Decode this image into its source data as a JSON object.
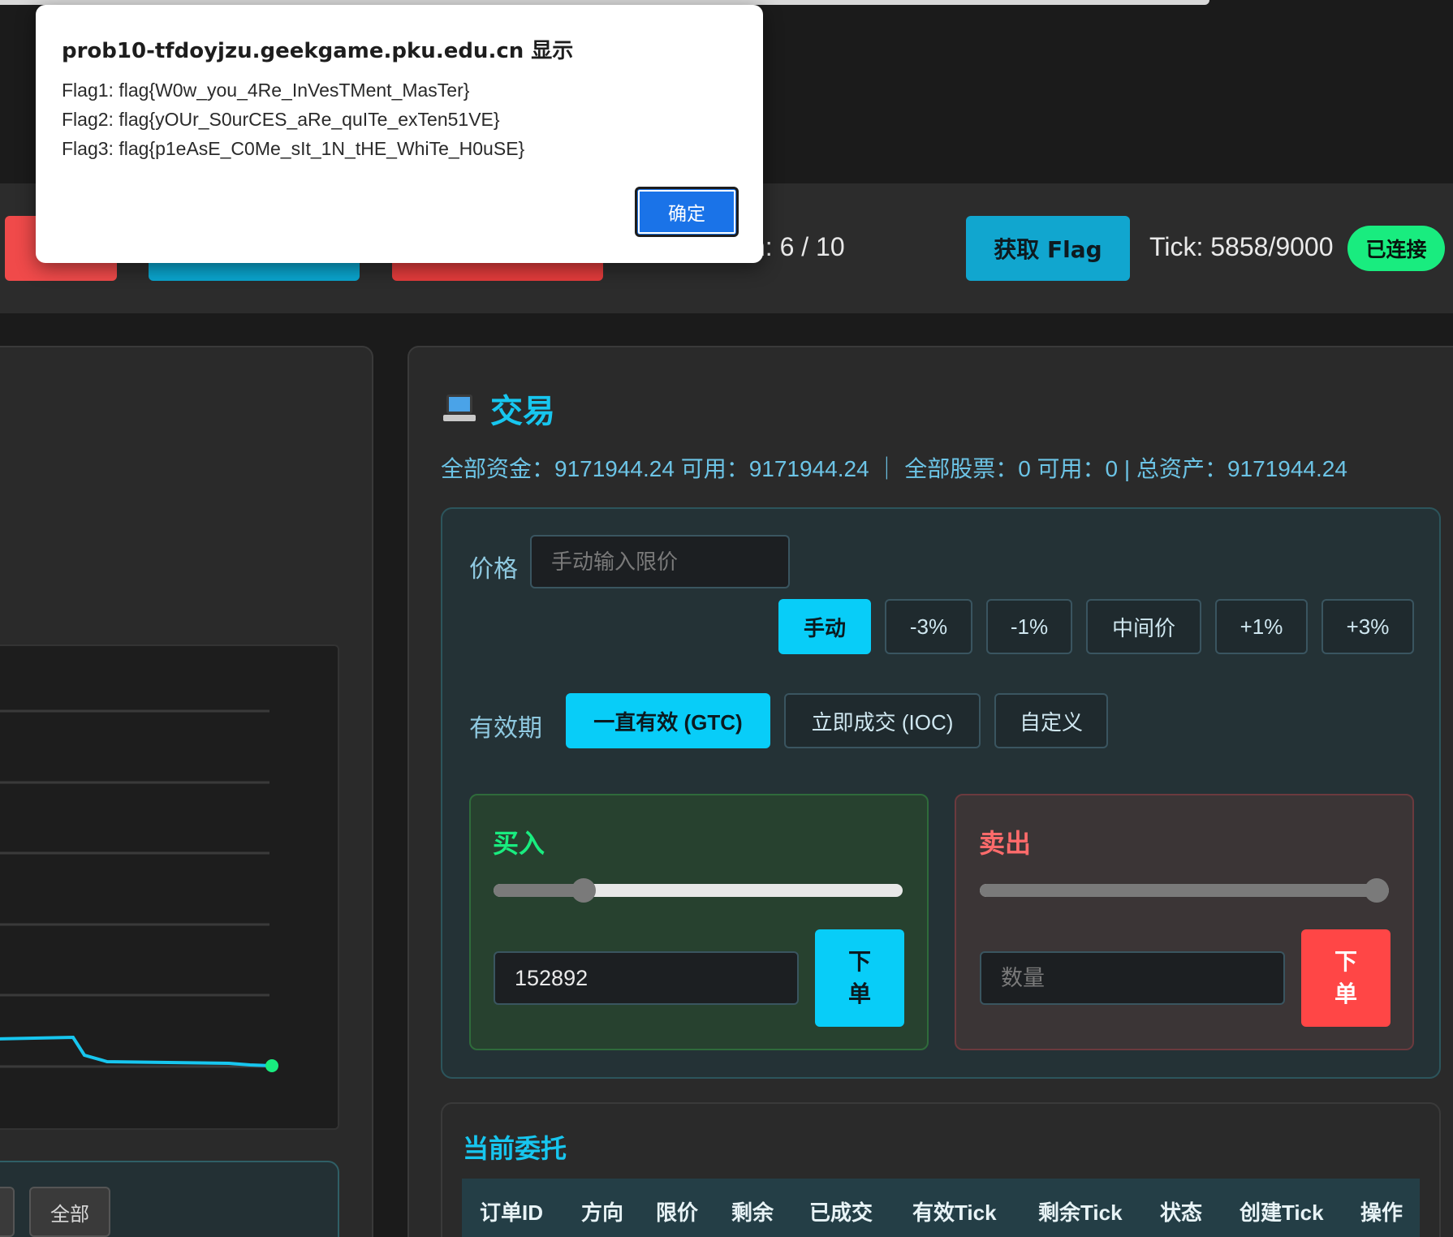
{
  "dialog": {
    "title": "prob10-tfdoyjzu.geekgame.pku.edu.cn 显示",
    "lines": [
      "Flag1: flag{W0w_you_4Re_InVesTMent_MasTer}",
      "Flag2: flag{yOUr_S0urCES_aRe_quITe_exTen51VE}",
      "Flag3: flag{p1eAsE_C0Me_sIt_1N_tHE_WhiTe_H0uSE}"
    ],
    "ok_label": "确定"
  },
  "header": {
    "round_text": "n: 6 / 10",
    "get_flag_label": "获取 Flag",
    "tick_text": "Tick: 5858/9000",
    "status_badge": "已连接"
  },
  "left_panel": {
    "range_all_label": "全部"
  },
  "trade": {
    "title": "交易",
    "title_icon": "laptop-icon",
    "funds_summary": "全部资金：9171944.24 可用：9171944.24 ｜ 全部股票：0 可用：0 | 总资产：9171944.24",
    "price_label": "价格",
    "price_placeholder": "手动输入限价",
    "price_modes": [
      "手动",
      "-3%",
      "-1%",
      "中间价",
      "+1%",
      "+3%"
    ],
    "price_mode_selected": "手动",
    "validity_label": "有效期",
    "validity_options": [
      "一直有效 (GTC)",
      "立即成交 (IOC)",
      "自定义"
    ],
    "validity_selected": "一直有效 (GTC)",
    "buy": {
      "title": "买入",
      "slider_fraction": 0.22,
      "quantity_value": "152892",
      "submit_label_1": "下",
      "submit_label_2": "单"
    },
    "sell": {
      "title": "卖出",
      "slider_fraction": 1.0,
      "quantity_placeholder": "数量",
      "submit_label_1": "下",
      "submit_label_2": "单"
    }
  },
  "orders": {
    "title": "当前委托",
    "columns": [
      "订单ID",
      "方向",
      "限价",
      "剩余",
      "已成交",
      "有效Tick",
      "剩余Tick",
      "状态",
      "创建Tick",
      "操作"
    ]
  },
  "colors": {
    "accent": "#08cdf8",
    "buy": "#19ec7f",
    "sell": "#ff4646",
    "connected": "#19ec7f"
  }
}
